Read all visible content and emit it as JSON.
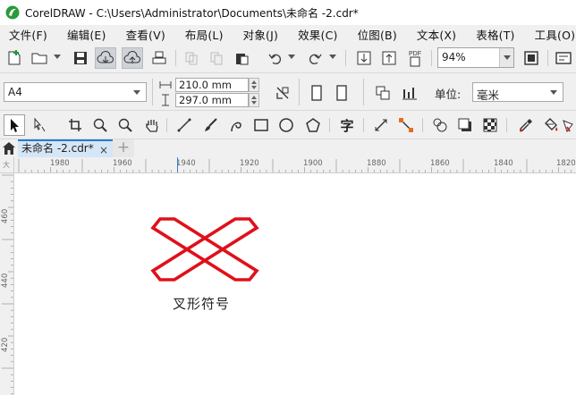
{
  "window": {
    "title": "CorelDRAW - C:\\Users\\Administrator\\Documents\\未命名 -2.cdr*"
  },
  "menu": [
    "文件(F)",
    "编辑(E)",
    "查看(V)",
    "布局(L)",
    "对象(J)",
    "效果(C)",
    "位图(B)",
    "文本(X)",
    "表格(T)",
    "工具(O)"
  ],
  "toolbar": {
    "zoom_value": "94%",
    "pdf_label": "PDF"
  },
  "property_bar": {
    "page_size": "A4",
    "width": "210.0 mm",
    "height": "297.0 mm",
    "units_label": "单位:",
    "units_value": "毫米"
  },
  "toolbox": {
    "text_tool_glyph": "字"
  },
  "tabs": {
    "doc_tab": "未命名 -2.cdr*",
    "close_glyph": "×",
    "add_glyph": "+"
  },
  "rulers": {
    "corner": "大",
    "horizontal": [
      "1980",
      "1960",
      "1940",
      "1920",
      "1900",
      "1880",
      "1860",
      "1840",
      "1820"
    ],
    "vertical": [
      "460",
      "440",
      "420"
    ]
  },
  "canvas": {
    "caption": "叉形符号",
    "symbol_color": "#e0101a"
  },
  "colors": {
    "accent": "#2a78c8",
    "icon_green": "#1a9a3a"
  }
}
